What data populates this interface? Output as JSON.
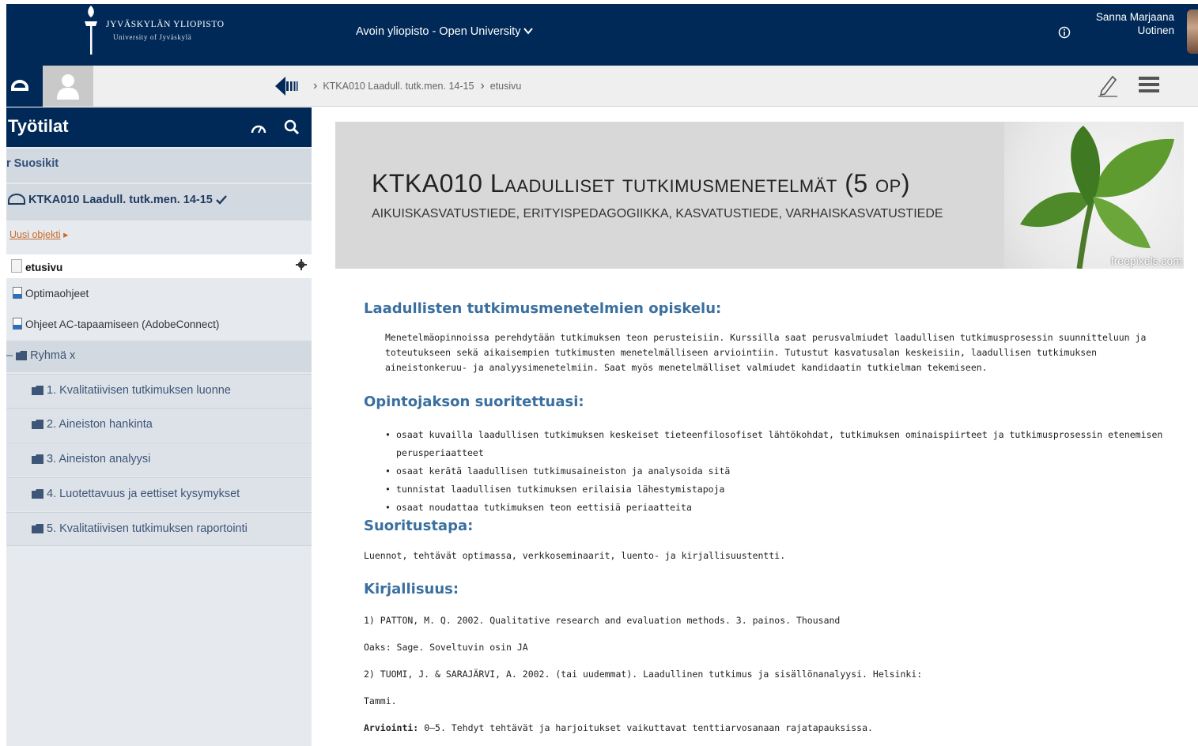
{
  "header": {
    "logo_line1": "JYVÄSKYLÄN YLIOPISTO",
    "logo_line2": "University of Jyväskylä",
    "uni_menu": "Avoin yliopisto - Open University",
    "user_name_line1": "Sanna Marjaana",
    "user_name_line2": "Uotinen"
  },
  "breadcrumb": {
    "items": [
      "KTKA010 Laadull. tutk.men. 14-15",
      "etusivu"
    ]
  },
  "sidebar": {
    "title": "Työtilat",
    "favorites": "Suosikit",
    "course": "KTKA010 Laadull. tutk.men. 14-15",
    "new_object": "Uusi objekti",
    "etusivu": "etusivu",
    "optima": "Optimaohjeet",
    "ohjeet": "Ohjeet AC-tapaamiseen (AdobeConnect)",
    "group": "Ryhmä x",
    "folders": [
      "1. Kvalitatiivisen tutkimuksen luonne",
      "2. Aineiston hankinta",
      "3. Aineiston analyysi",
      "4. Luotettavuus ja eettiset kysymykset",
      "5. Kvalitatiivisen tutkimuksen raportointi"
    ]
  },
  "banner": {
    "title": "KTKA010 Laadulliset tutkimusmenetelmät (5 op)",
    "subtitle": "AIKUISKASVATUSTIEDE, ERITYISPEDAGOGIIKKA, KASVATUSTIEDE, VARHAISKASVATUSTIEDE",
    "credit": "freepixels.com"
  },
  "content": {
    "h1": "Laadullisten tutkimusmenetelmien opiskelu:",
    "p1": "Menetelmäopinnoissa perehdytään tutkimuksen teon perusteisiin. Kurssilla saat perusvalmiudet laadullisen tutkimusprosessin suunnitteluun ja toteutukseen sekä aikaisempien tutkimusten menetelmälliseen arviointiin. Tutustut kasvatusalan keskeisiin, laadullisen tutkimuksen aineistonkeruu- ja analyysimenetelmiin. Saat myös menetelmälliset valmiudet kandidaatin tutkielman tekemiseen.",
    "h2": "Opintojakson suoritettuasi:",
    "bullets": [
      "osaat kuvailla laadullisen tutkimuksen keskeiset tieteenfilosofiset lähtökohdat, tutkimuksen ominaispiirteet ja tutkimusprosessin etenemisen perusperiaatteet",
      "osaat kerätä laadullisen tutkimusaineiston ja analysoida sitä",
      "tunnistat laadullisen tutkimuksen erilaisia lähestymistapoja",
      "osaat noudattaa tutkimuksen teon eettisiä periaatteita"
    ],
    "h3": "Suoritustapa:",
    "p3": "Luennot, tehtävät optimassa, verkkoseminaarit, luento- ja kirjallisuustentti.",
    "h4": "Kirjallisuus:",
    "lit1": "1) PATTON, M. Q. 2002. Qualitative research and evaluation methods. 3. painos. Thousand",
    "lit2": "Oaks: Sage. Soveltuvin osin JA",
    "lit3": "2) TUOMI, J. & SARAJÄRVI, A. 2002. (tai uudemmat). Laadullinen tutkimus ja sisällönanalyysi. Helsinki:",
    "lit4": "Tammi.",
    "grading_label": "Arviointi:",
    "grading_text": "0–5. Tehdyt tehtävät ja harjoitukset vaikuttavat tenttiarvosanaan rajatapauksissa."
  }
}
